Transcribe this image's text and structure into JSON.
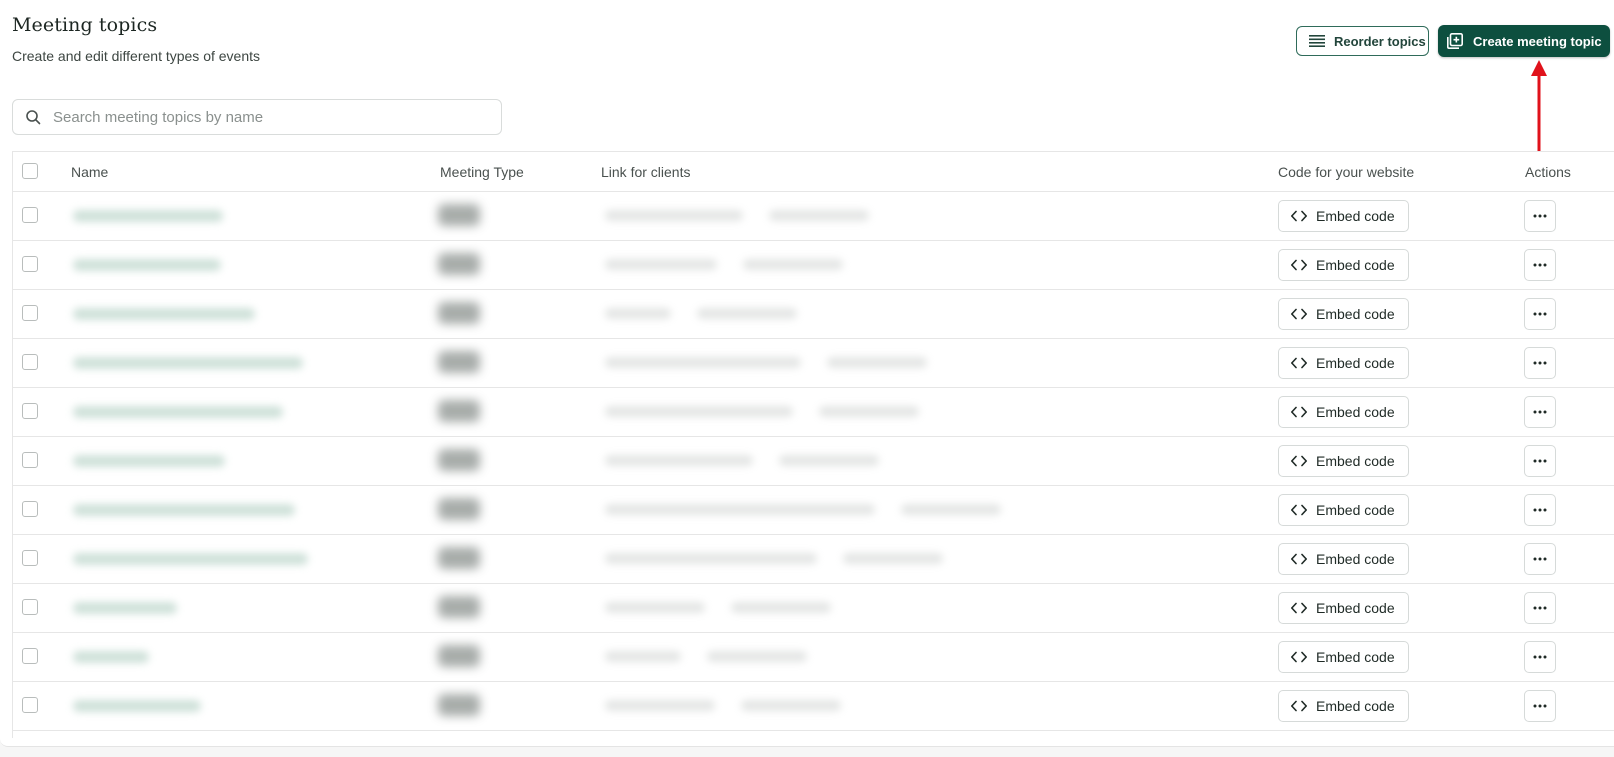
{
  "header": {
    "title": "Meeting topics",
    "subtitle": "Create and edit different types of events",
    "reorder_label": "Reorder topics",
    "create_label": "Create meeting topic"
  },
  "search": {
    "placeholder": "Search meeting topics by name",
    "value": ""
  },
  "table": {
    "columns": {
      "name": "Name",
      "meeting_type": "Meeting Type",
      "link": "Link for clients",
      "code": "Code for your website",
      "actions": "Actions"
    },
    "embed_label": "Embed code",
    "row_count": 11
  },
  "colors": {
    "primary": "#0d4f3f",
    "annotation_arrow": "#e0121b"
  },
  "icons": {
    "reorder": "list-lines-icon",
    "create": "add-square-icon",
    "search": "search-icon",
    "embed": "code-brackets-icon",
    "more": "ellipsis-icon"
  }
}
